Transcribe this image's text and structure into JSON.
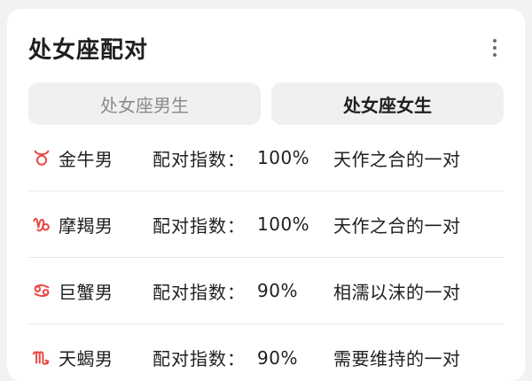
{
  "header": {
    "title": "处女座配对"
  },
  "tabs": [
    {
      "label": "处女座男生"
    },
    {
      "label": "处女座女生"
    }
  ],
  "matches": [
    {
      "icon": "taurus-icon",
      "name": "金牛男",
      "score_label": "配对指数：",
      "score": "100%",
      "description": "天作之合的一对"
    },
    {
      "icon": "capricorn-icon",
      "name": "摩羯男",
      "score_label": "配对指数：",
      "score": "100%",
      "description": "天作之合的一对"
    },
    {
      "icon": "cancer-icon",
      "name": "巨蟹男",
      "score_label": "配对指数：",
      "score": "90%",
      "description": "相濡以沫的一对"
    },
    {
      "icon": "scorpio-icon",
      "name": "天蝎男",
      "score_label": "配对指数：",
      "score": "90%",
      "description": "需要维持的一对"
    }
  ],
  "colors": {
    "zodiac_icon": "#e74a43",
    "text_primary": "#1f1f1f",
    "text_secondary": "#8b8b8b",
    "card": "#ffffff",
    "tab_bg": "#f0f0f0",
    "page_bg": "#f2f2f2"
  }
}
